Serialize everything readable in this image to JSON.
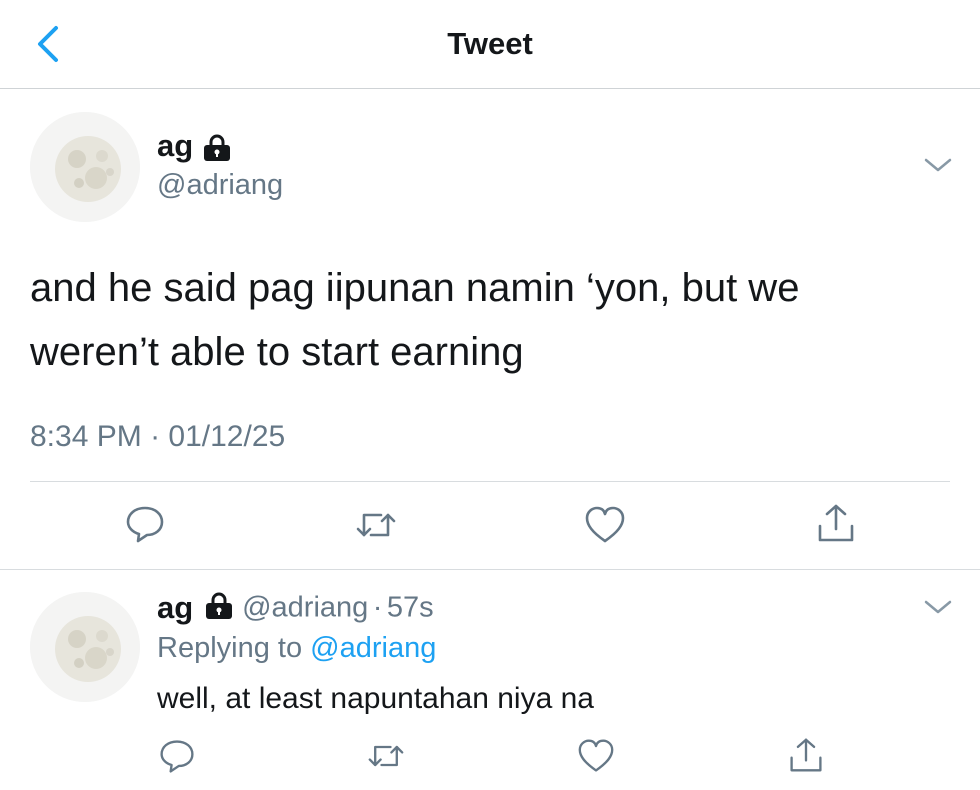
{
  "header": {
    "title": "Tweet",
    "back_icon": "chevron-left-icon",
    "accent": "#1da1f2"
  },
  "tweet": {
    "display_name": "ag",
    "handle": "@adriang",
    "protected_icon": "lock-icon",
    "text": "and he said pag iipunan namin ‘yon, but we weren’t able to start earning",
    "time": "8:34 PM",
    "separator": "·",
    "date": "01/12/25",
    "actions": [
      "reply-icon",
      "retweet-icon",
      "like-icon",
      "share-icon"
    ]
  },
  "reply": {
    "display_name": "ag",
    "handle": "@adriang",
    "separator": "·",
    "age": "57s",
    "replying_to_prefix": "Replying to",
    "replying_to_handle": "@adriang",
    "text": "well, at least napuntahan niya na",
    "actions": [
      "reply-icon",
      "retweet-icon",
      "like-icon",
      "share-icon"
    ]
  },
  "colors": {
    "text_primary": "#14171a",
    "text_secondary": "#657786",
    "link": "#1da1f2",
    "divider": "#d8dcdf"
  }
}
